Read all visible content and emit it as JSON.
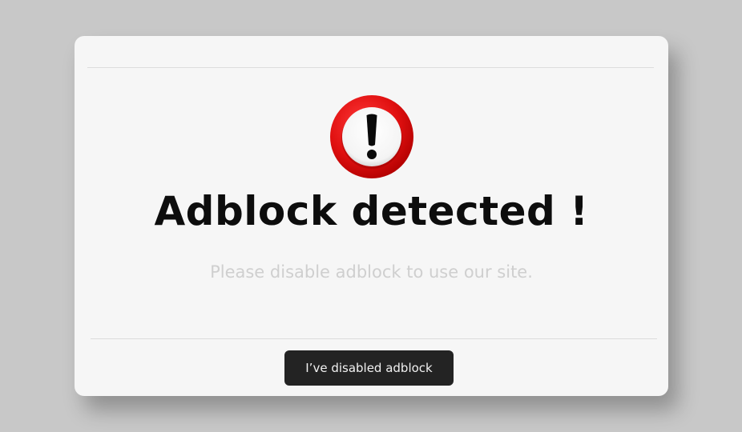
{
  "modal": {
    "title": "Adblock detected !",
    "message": "Please disable adblock to use our site.",
    "confirm_label": "I’ve disabled adblock",
    "icon": "exclamation-warning-icon"
  },
  "colors": {
    "background": "#c8c8c8",
    "modal_background": "#f6f6f6",
    "icon_red": "#e01010",
    "title": "#0d0d0d",
    "subtitle": "#cfcfcf",
    "button_background": "#232323",
    "button_text": "#f1f1f1"
  }
}
